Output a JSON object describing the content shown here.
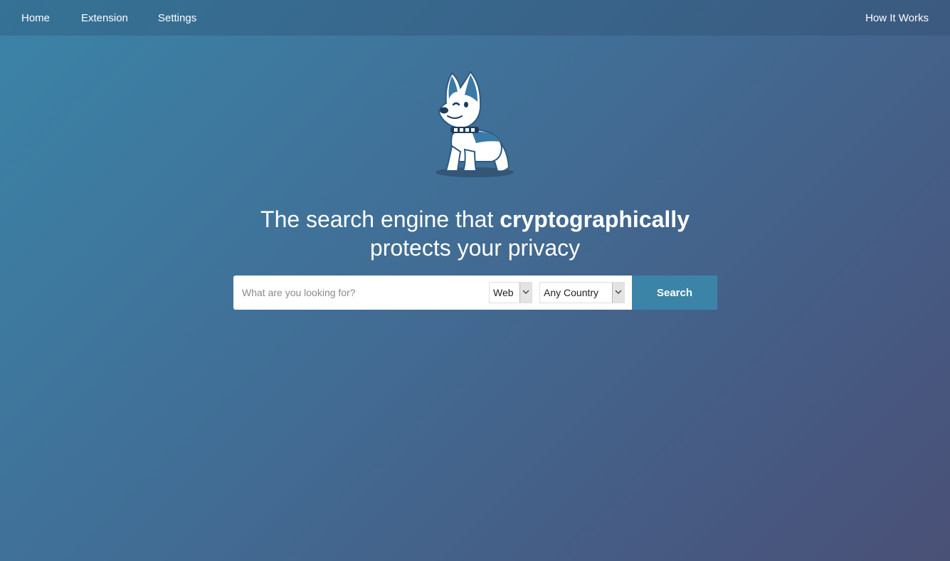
{
  "nav": {
    "home": "Home",
    "extension": "Extension",
    "settings": "Settings",
    "how_it_works": "How It Works"
  },
  "hero": {
    "mascot": "husky-dog-mascot-logo",
    "headline_part1": "The search engine that ",
    "headline_bold": "cryptographically",
    "headline_part2": "protects your privacy"
  },
  "search": {
    "placeholder": "What are you looking for?",
    "type_selected": "Web",
    "country_selected": "Any Country",
    "button_label": "Search"
  },
  "colors": {
    "accent": "#3b84a8",
    "background_start": "#3b84a8",
    "background_end": "#4a5176"
  }
}
